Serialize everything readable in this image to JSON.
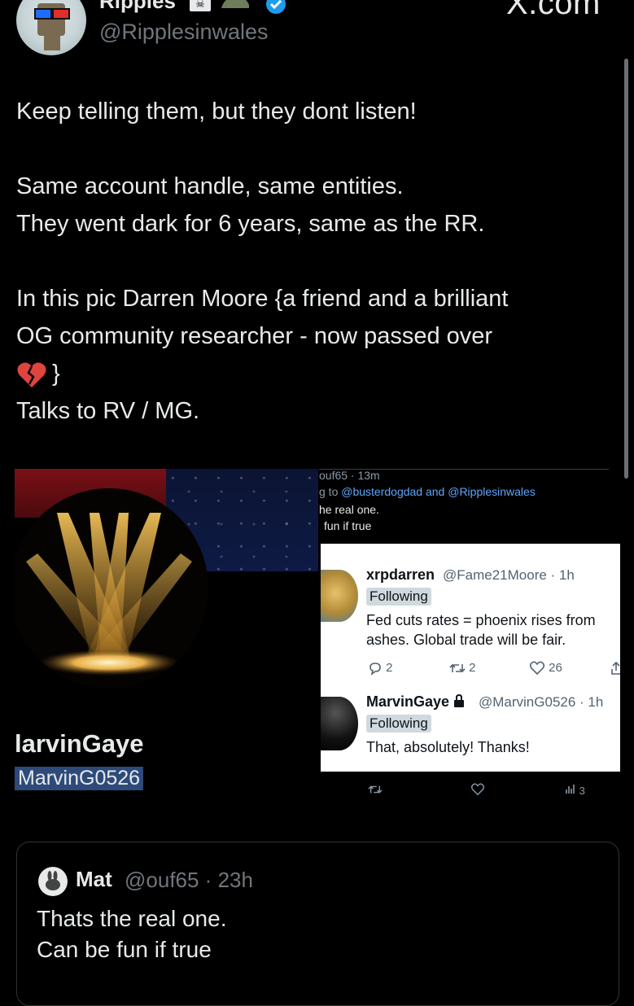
{
  "header": {
    "display_name": "Ripples",
    "handle": "@Ripplesinwales",
    "site": "X.com"
  },
  "tweet": {
    "lines": [
      "Keep telling them, but they dont listen!",
      "Same account handle, same entities.",
      "They went dark for 6 years, same as the RR.",
      "In this pic Darren Moore {a friend and a brilliant",
      "OG community researcher -  now passed over",
      "}",
      "Talks to RV / MG."
    ]
  },
  "media": {
    "profile": {
      "name": "larvinGaye",
      "handle": "MarvinG0526"
    },
    "reply_thread": {
      "meta": "ouf65 · 13m",
      "reply_prefix": "g to",
      "reply_mentions": "@busterdogdad and @Ripplesinwales",
      "text_line1": "he real one.",
      "text_line2": "fun if true"
    },
    "darren_tweet": {
      "name": "xrpdarren",
      "handle": "@Fame21Moore · 1h",
      "following_label": "Following",
      "text_line1": "Fed cuts rates = phoenix rises from",
      "text_line2": "ashes.  Global trade will be fair.",
      "replies": "2",
      "retweets": "2",
      "likes": "26"
    },
    "marvin_tweet": {
      "name": "MarvinGaye",
      "handle": "@MarvinG0526 · 1h",
      "following_label": "Following",
      "text": "That, absolutely! Thanks!"
    },
    "bottom_actions": {
      "views": "3"
    }
  },
  "quote": {
    "name": "Mat",
    "handle": "@ouf65 · 23h",
    "lines": [
      "Thats the real one.",
      "Can be fun if true"
    ]
  }
}
